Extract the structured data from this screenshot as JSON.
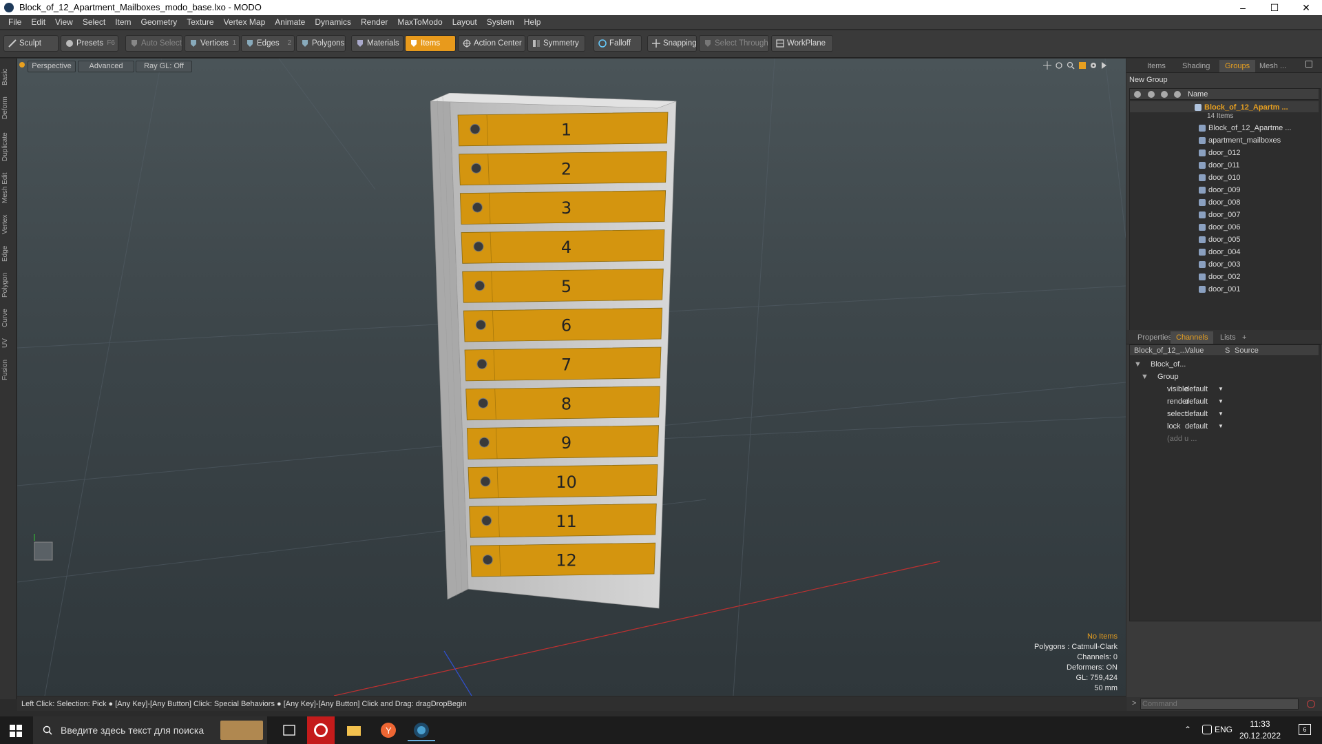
{
  "window": {
    "title": "Block_of_12_Apartment_Mailboxes_modo_base.lxo - MODO"
  },
  "menu": [
    "File",
    "Edit",
    "View",
    "Select",
    "Item",
    "Geometry",
    "Texture",
    "Vertex Map",
    "Animate",
    "Dynamics",
    "Render",
    "MaxToModo",
    "Layout",
    "System",
    "Help"
  ],
  "toolbar": {
    "sculpt": "Sculpt",
    "presets": "Presets",
    "presets_key": "F6",
    "auto_select": "Auto Select",
    "vertices": "Vertices",
    "vertices_key": "1",
    "edges": "Edges",
    "edges_key": "2",
    "polygons": "Polygons",
    "materials": "Materials",
    "items": "Items",
    "action_center": "Action Center",
    "symmetry": "Symmetry",
    "falloff": "Falloff",
    "snapping": "Snapping",
    "select_through": "Select Through",
    "workplane": "WorkPlane"
  },
  "left_tabs": [
    "Basic",
    "Deform",
    "Duplicate",
    "Mesh Edit",
    "Vertex",
    "Edge",
    "Polygon",
    "Curve",
    "UV",
    "Fusion"
  ],
  "viewport": {
    "perspective": "Perspective",
    "advanced": "Advanced",
    "raygl": "Ray GL: Off",
    "info": {
      "items": "No Items",
      "polygons": "Polygons : Catmull-Clark",
      "channels": "Channels: 0",
      "deformers": "Deformers: ON",
      "gl": "GL: 759,424",
      "size": "50 mm"
    },
    "mailbox_numbers": [
      "1",
      "2",
      "3",
      "4",
      "5",
      "6",
      "7",
      "8",
      "9",
      "10",
      "11",
      "12"
    ]
  },
  "right_panel": {
    "tabs": [
      "Items",
      "Shading",
      "Groups",
      "Mesh ..."
    ],
    "new_group": "New Group",
    "name_header": "Name",
    "group_name": "Block_of_12_Apartm ...",
    "group_count": "14 Items",
    "items": [
      "Block_of_12_Apartme ...",
      "apartment_mailboxes",
      "door_012",
      "door_011",
      "door_010",
      "door_009",
      "door_008",
      "door_007",
      "door_006",
      "door_005",
      "door_004",
      "door_003",
      "door_002",
      "door_001"
    ],
    "bottom_tabs": [
      "Properties",
      "Channels",
      "Lists",
      "+"
    ],
    "channels_header": {
      "name": "Block_of_12_...",
      "value": "Value",
      "s": "S",
      "source": "Source"
    },
    "channel_tree": {
      "root": "Block_of...",
      "group": "Group"
    },
    "channels": [
      {
        "name": "visible",
        "value": "default"
      },
      {
        "name": "render",
        "value": "default"
      },
      {
        "name": "select",
        "value": "default"
      },
      {
        "name": "lock",
        "value": "default"
      }
    ],
    "add_user": "(add u ...",
    "command_placeholder": "Command"
  },
  "status": {
    "text": "Left Click: Selection: Pick ● [Any Key]-[Any Button] Click: Special Behaviors ● [Any Key]-[Any Button] Click and Drag: dragDropBegin"
  },
  "taskbar": {
    "search": "Введите здесь текст для поиска",
    "lang": "ENG",
    "time": "11:33",
    "date": "20.12.2022",
    "notif": "6"
  },
  "colors": {
    "accent": "#e89a1c",
    "door": "#d4950f",
    "viewport_bg": "#3c4549"
  }
}
